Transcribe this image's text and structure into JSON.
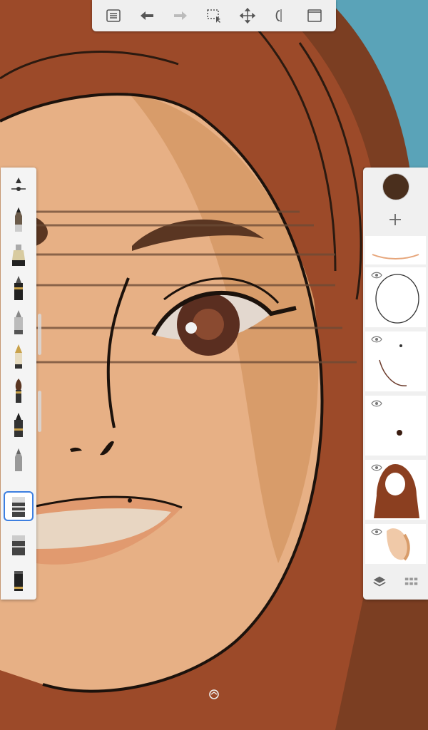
{
  "app": {
    "accent_color": "#3d7fe0",
    "current_color": "#4a2f1d"
  },
  "toolbar": {
    "items": [
      {
        "icon": "list-menu-icon"
      },
      {
        "icon": "undo-icon"
      },
      {
        "icon": "redo-icon"
      },
      {
        "icon": "selection-icon"
      },
      {
        "icon": "transform-icon"
      },
      {
        "icon": "symmetry-icon"
      },
      {
        "icon": "fullscreen-icon"
      }
    ]
  },
  "brushes": {
    "items": [
      {
        "icon": "brush-size-slider-icon"
      },
      {
        "icon": "pencil-icon"
      },
      {
        "icon": "marker-icon"
      },
      {
        "icon": "ballpoint-pen-icon"
      },
      {
        "icon": "felt-tip-icon"
      },
      {
        "icon": "fountain-pen-icon"
      },
      {
        "icon": "paint-brush-icon"
      },
      {
        "icon": "ink-pen-icon"
      },
      {
        "icon": "airbrush-icon"
      },
      {
        "icon": "hard-eraser-icon",
        "selected": true
      },
      {
        "icon": "soft-eraser-icon"
      },
      {
        "icon": "chisel-marker-icon"
      }
    ]
  },
  "layers": {
    "items": [
      {
        "name": "layer-partial-top",
        "visible": true
      },
      {
        "name": "layer-face-outline",
        "visible": true
      },
      {
        "name": "layer-chin-sketch",
        "visible": true
      },
      {
        "name": "layer-dot",
        "visible": true
      },
      {
        "name": "layer-hijab",
        "visible": true
      },
      {
        "name": "layer-face-skin",
        "visible": true
      }
    ]
  }
}
